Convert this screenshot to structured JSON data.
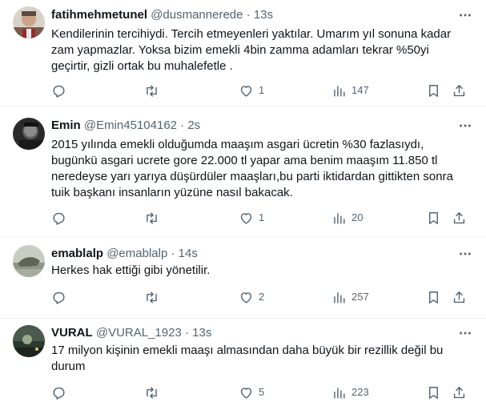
{
  "tweets": [
    {
      "name": "fatihmehmetunel",
      "handle": "@dusmannerede",
      "separator": "·",
      "time": "13s",
      "text": "Kendilerinin tercihiydi. Tercih etmeyenleri yaktılar. Umarım yıl sonuna kadar zam yapmazlar. Yoksa bizim emekli 4bin zamma adamları tekrar %50yi geçirtir, gizli ortak bu muhalefetle .",
      "likes": "1",
      "views": "147",
      "avatar_icon": "man-portrait-avatar"
    },
    {
      "name": "Emin",
      "handle": "@Emin45104162",
      "separator": "·",
      "time": "2s",
      "text": "2015 yılında emekli olduğumda maaşım asgari ücretin %30 fazlasıydı, bugünkü asgari ucrete gore 22.000 tl yapar ama benim maaşım 11.850 tl neredeyse yarı yarıya düşürdüler maaşları,bu parti iktidardan gittikten sonra tuik başkanı insanların yüzüne nasıl bakacak.",
      "likes": "1",
      "views": "20",
      "avatar_icon": "dark-portrait-avatar"
    },
    {
      "name": "emablalp",
      "handle": "@emablalp",
      "separator": "·",
      "time": "14s",
      "text": "Herkes hak ettiği gibi yönetilir.",
      "likes": "2",
      "views": "257",
      "avatar_icon": "landscape-avatar"
    },
    {
      "name": "VURAL",
      "handle": "@VURAL_1923",
      "separator": "·",
      "time": "13s",
      "text": "17 milyon kişinin emekli maaşı almasından daha büyük bir rezillik değil bu durum",
      "likes": "5",
      "views": "223",
      "avatar_icon": "night-scene-avatar"
    }
  ],
  "colors": {
    "text_primary": "#0f1419",
    "text_secondary": "#536471",
    "divider": "#eff3f4"
  }
}
